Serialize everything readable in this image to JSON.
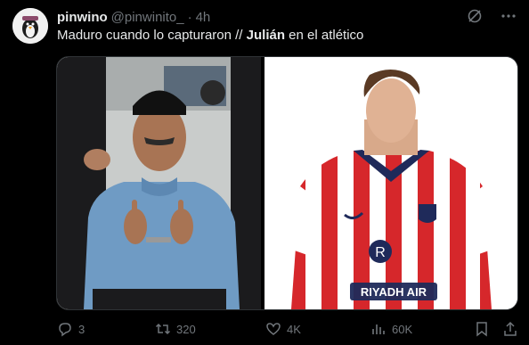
{
  "tweet": {
    "display_name": "pinwino",
    "handle": "@pinwinito_",
    "separator": "·",
    "time": "4h",
    "text_part1": "Maduro cuando lo capturaron // ",
    "text_bold": "Julián",
    "text_part2": " en el atlético"
  },
  "media": {
    "right_sponsor": "RIYADH AIR"
  },
  "actions": {
    "replies": "3",
    "retweets": "320",
    "likes": "4K",
    "views": "60K"
  },
  "colors": {
    "background": "#000000",
    "text": "#e7e9ea",
    "muted": "#71767b",
    "jersey_red": "#d6272b",
    "jersey_navy": "#1f2a5a",
    "sweater_blue": "#6f9bc4"
  },
  "icons": [
    "grok-icon",
    "more-icon",
    "reply-icon",
    "retweet-icon",
    "like-icon",
    "views-icon",
    "bookmark-icon",
    "share-icon"
  ]
}
